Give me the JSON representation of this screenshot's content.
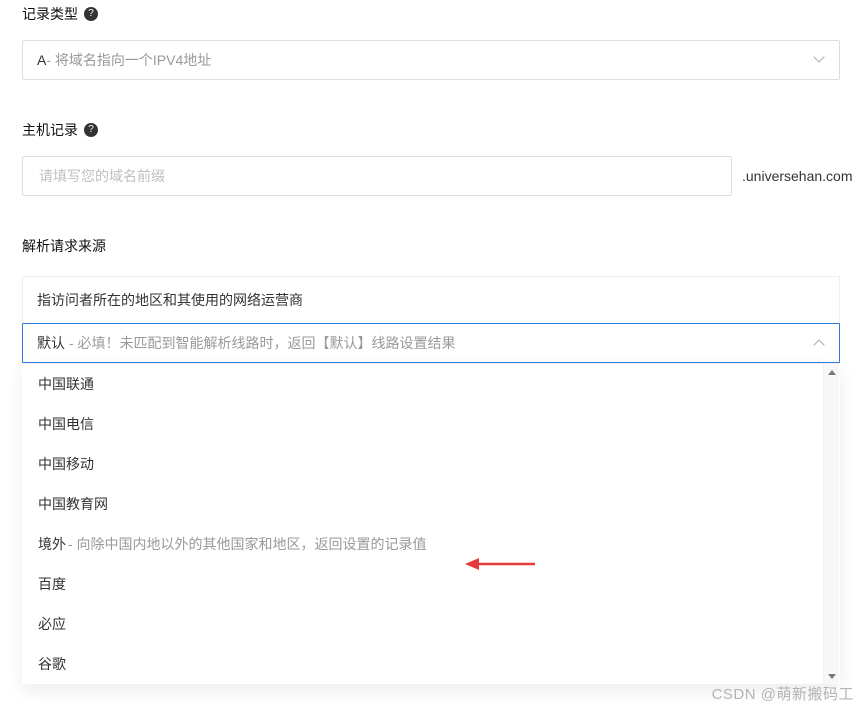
{
  "record_type": {
    "label": "记录类型",
    "value_prefix": "A",
    "value_desc": "- 将域名指向一个IPV4地址"
  },
  "host_record": {
    "label": "主机记录",
    "placeholder": "请填写您的域名前缀",
    "suffix": ".universehan.com"
  },
  "source": {
    "label": "解析请求来源",
    "header": "指访问者所在的地区和其使用的网络运营商",
    "selected_name": "默认",
    "selected_hint": " - 必填！未匹配到智能解析线路时，返回【默认】线路设置结果",
    "options": [
      {
        "name": "中国联通",
        "desc": ""
      },
      {
        "name": "中国电信",
        "desc": ""
      },
      {
        "name": "中国移动",
        "desc": ""
      },
      {
        "name": "中国教育网",
        "desc": ""
      },
      {
        "name": "境外",
        "desc": " - 向除中国内地以外的其他国家和地区，返回设置的记录值"
      },
      {
        "name": "百度",
        "desc": ""
      },
      {
        "name": "必应",
        "desc": ""
      },
      {
        "name": "谷歌",
        "desc": ""
      }
    ]
  },
  "watermark": "CSDN @萌新搬码工"
}
